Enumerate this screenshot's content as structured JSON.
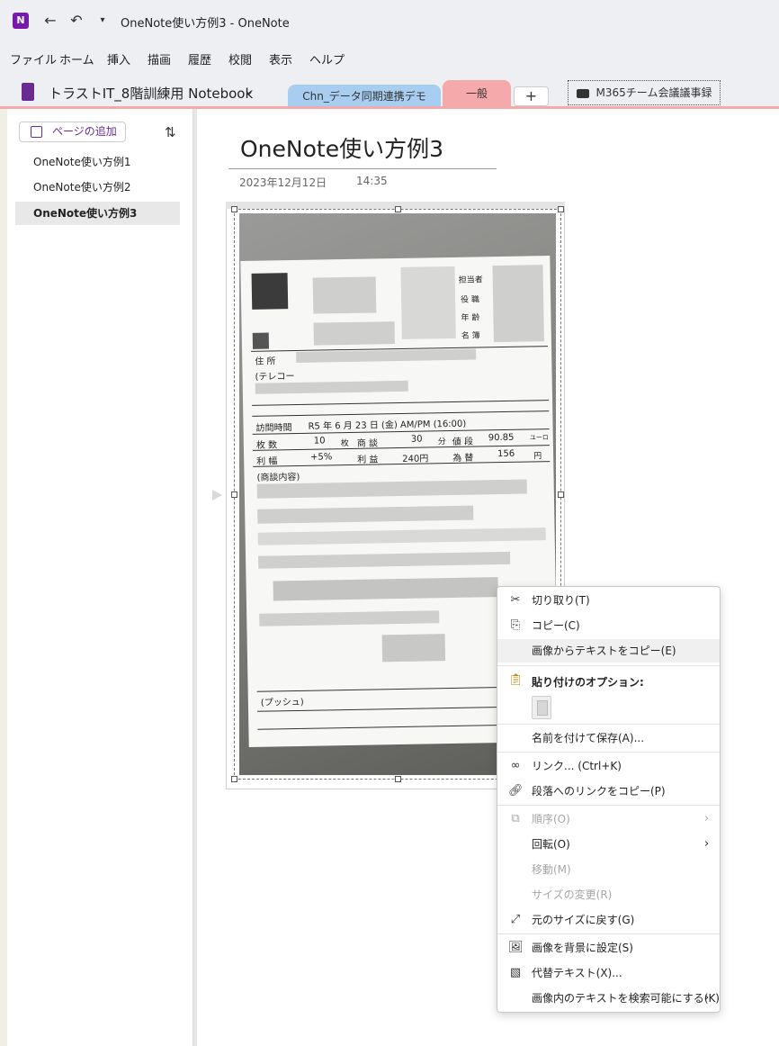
{
  "window": {
    "app_icon_letter": "N",
    "title": "OneNote使い方例3  -  OneNote"
  },
  "menu": [
    "ファイル",
    "ホーム",
    "挿入",
    "描画",
    "履歴",
    "校閲",
    "表示",
    "ヘルプ"
  ],
  "notebook": {
    "name": "トラストIT_8階訓練用 Notebook"
  },
  "sections": {
    "chn": "Chn_データ同期連携デモ",
    "general": "一般",
    "add": "+",
    "m365": "M365チーム会議議事録"
  },
  "page_list": {
    "add_page": "ページの追加",
    "pages": [
      "OneNote使い方例1",
      "OneNote使い方例2",
      "OneNote使い方例3"
    ],
    "selected_index": 2
  },
  "page": {
    "title": "OneNote使い方例3",
    "date": "2023年12月12日",
    "time": "14:35"
  },
  "photo_form": {
    "rows": [
      "担当者",
      "役 職",
      "年 齢",
      "名 簿"
    ],
    "address": "住 所",
    "tel": "(テレコー",
    "visit_time_label": "訪問時間",
    "visit_time_value": "R5 年 6 月 23 日 (金) AM/PM (16:00)",
    "count_label": "枚 数",
    "count_value": "10",
    "count_unit": "枚",
    "deal_label": "商 談",
    "deal_value": "30",
    "deal_unit": "分",
    "price_label": "値 段",
    "price_value": "90.85",
    "price_unit": "ユーロ",
    "margin_label": "利 幅",
    "margin_value": "+5%",
    "profit_label": "利 益",
    "profit_value": "240円",
    "fx_label": "為 替",
    "fx_value": "156",
    "fx_unit": "円",
    "content_label": "(商談内容)",
    "push_label": "(プッシュ)"
  },
  "context_menu": {
    "cut": "切り取り(T)",
    "copy": "コピー(C)",
    "copy_text_from_image": "画像からテキストをコピー(E)",
    "paste_options": "貼り付けのオプション:",
    "save_as": "名前を付けて保存(A)...",
    "link": "リンク...  (Ctrl+K)",
    "copy_paragraph_link": "段落へのリンクをコピー(P)",
    "order": "順序(O)",
    "rotate": "回転(O)",
    "move": "移動(M)",
    "resize": "サイズの変更(R)",
    "restore_size": "元のサイズに戻す(G)",
    "set_as_background": "画像を背景に設定(S)",
    "alt_text": "代替テキスト(X)...",
    "make_searchable": "画像内のテキストを検索可能にする(K)"
  },
  "colors": {
    "accent": "#7719aa",
    "tab_chn": "#a7cdf0",
    "tab_general": "#f5a9ab"
  }
}
